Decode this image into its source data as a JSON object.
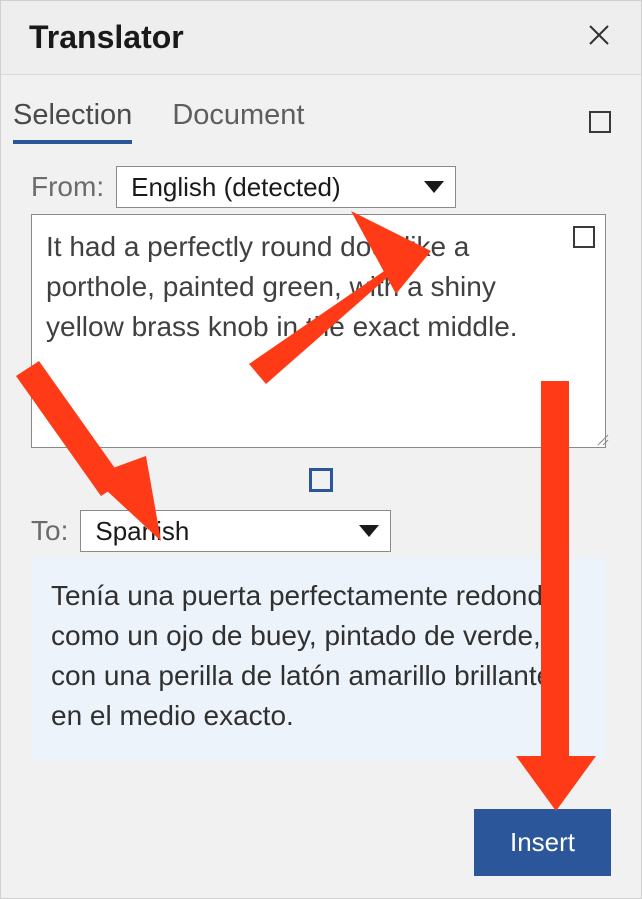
{
  "header": {
    "title": "Translator"
  },
  "tabs": {
    "selection": "Selection",
    "document": "Document"
  },
  "from": {
    "label": "From:",
    "selected": "English (detected)"
  },
  "source_text": "It had a perfectly round door like a porthole, painted green, with a shiny yellow brass knob in the exact middle.",
  "to": {
    "label": "To:",
    "selected": "Spanish"
  },
  "translation_text": "Tenía una puerta perfectamente redonda como un ojo de buey, pintado de verde, con una perilla de latón amarillo brillante en el medio exacto.",
  "footer": {
    "insert_label": "Insert"
  }
}
